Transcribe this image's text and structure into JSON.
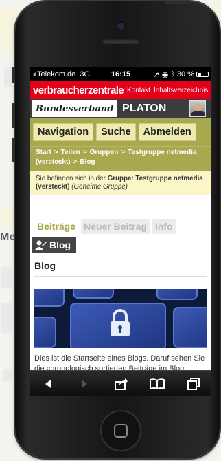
{
  "status_bar": {
    "signal": "ııl",
    "carrier": "Telekom.de",
    "network": "3G",
    "time": "16:15",
    "battery_text": "30 %",
    "battery_level": 0.3
  },
  "site_header": {
    "logo_text": "verbraucherzentrale",
    "links": [
      "Kontakt",
      "Inhaltsverzeichnis"
    ],
    "brand_subtitle": "Bundesverband",
    "app_name": "PLATON"
  },
  "nav": {
    "buttons": [
      "Navigation",
      "Suche",
      "Abmelden"
    ]
  },
  "breadcrumb": {
    "items": [
      "Start",
      "Teilen",
      "Gruppen",
      "Testgruppe netmedia (versteckt)",
      "Blog"
    ],
    "separator": ">"
  },
  "group_info": {
    "prefix": "Sie befinden sich in der",
    "label": "Gruppe: Testgruppe netmedia (versteckt)",
    "suffix": "(Geheime Gruppe)"
  },
  "tabs": [
    "Beiträge",
    "Neuer Beitrag",
    "Info"
  ],
  "blog_tag": "Blog",
  "content": {
    "heading": "Blog",
    "description": "Dies ist die Startseite eines Blogs. Daruf sehen Sie die chronologisch sortierten Beiträge im Blog."
  },
  "background": {
    "partial_text": "Me"
  },
  "colors": {
    "vz_red": "#e2001a",
    "olive": "#a8a84e",
    "pale_yellow": "#fbf6c8",
    "dark_gray": "#3c3c3c"
  },
  "icons": {
    "toolbar": [
      "back-arrow-icon",
      "forward-arrow-icon",
      "share-icon",
      "bookmarks-icon",
      "tabs-icon"
    ],
    "blog_tag": "user-pen-icon"
  }
}
